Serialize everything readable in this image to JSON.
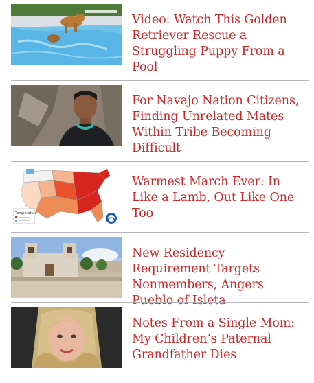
{
  "articles": [
    {
      "title": "Video: Watch This Golden Retriever Rescue a Struggling Puppy From a Pool",
      "image": "dog-pool-photo"
    },
    {
      "title": "For Navajo Nation Citizens, Finding Unrelated Mates Within Tribe Becoming Difficult",
      "image": "navajo-man-photo"
    },
    {
      "title": "Warmest March Ever: In Like a Lamb, Out Like One Too",
      "image": "us-temperature-map",
      "map_legend": {
        "title": "Temperature"
      }
    },
    {
      "title": "New Residency Requirement Targets Nonmembers, Angers Pueblo of Isleta",
      "image": "isleta-church-photo"
    },
    {
      "title": "Notes From a Single Mom: My Children’s Paternal Grandfather Dies",
      "image": "single-mom-portrait"
    }
  ],
  "colors": {
    "link": "#c8292b",
    "separator": "#b5b5b5"
  }
}
